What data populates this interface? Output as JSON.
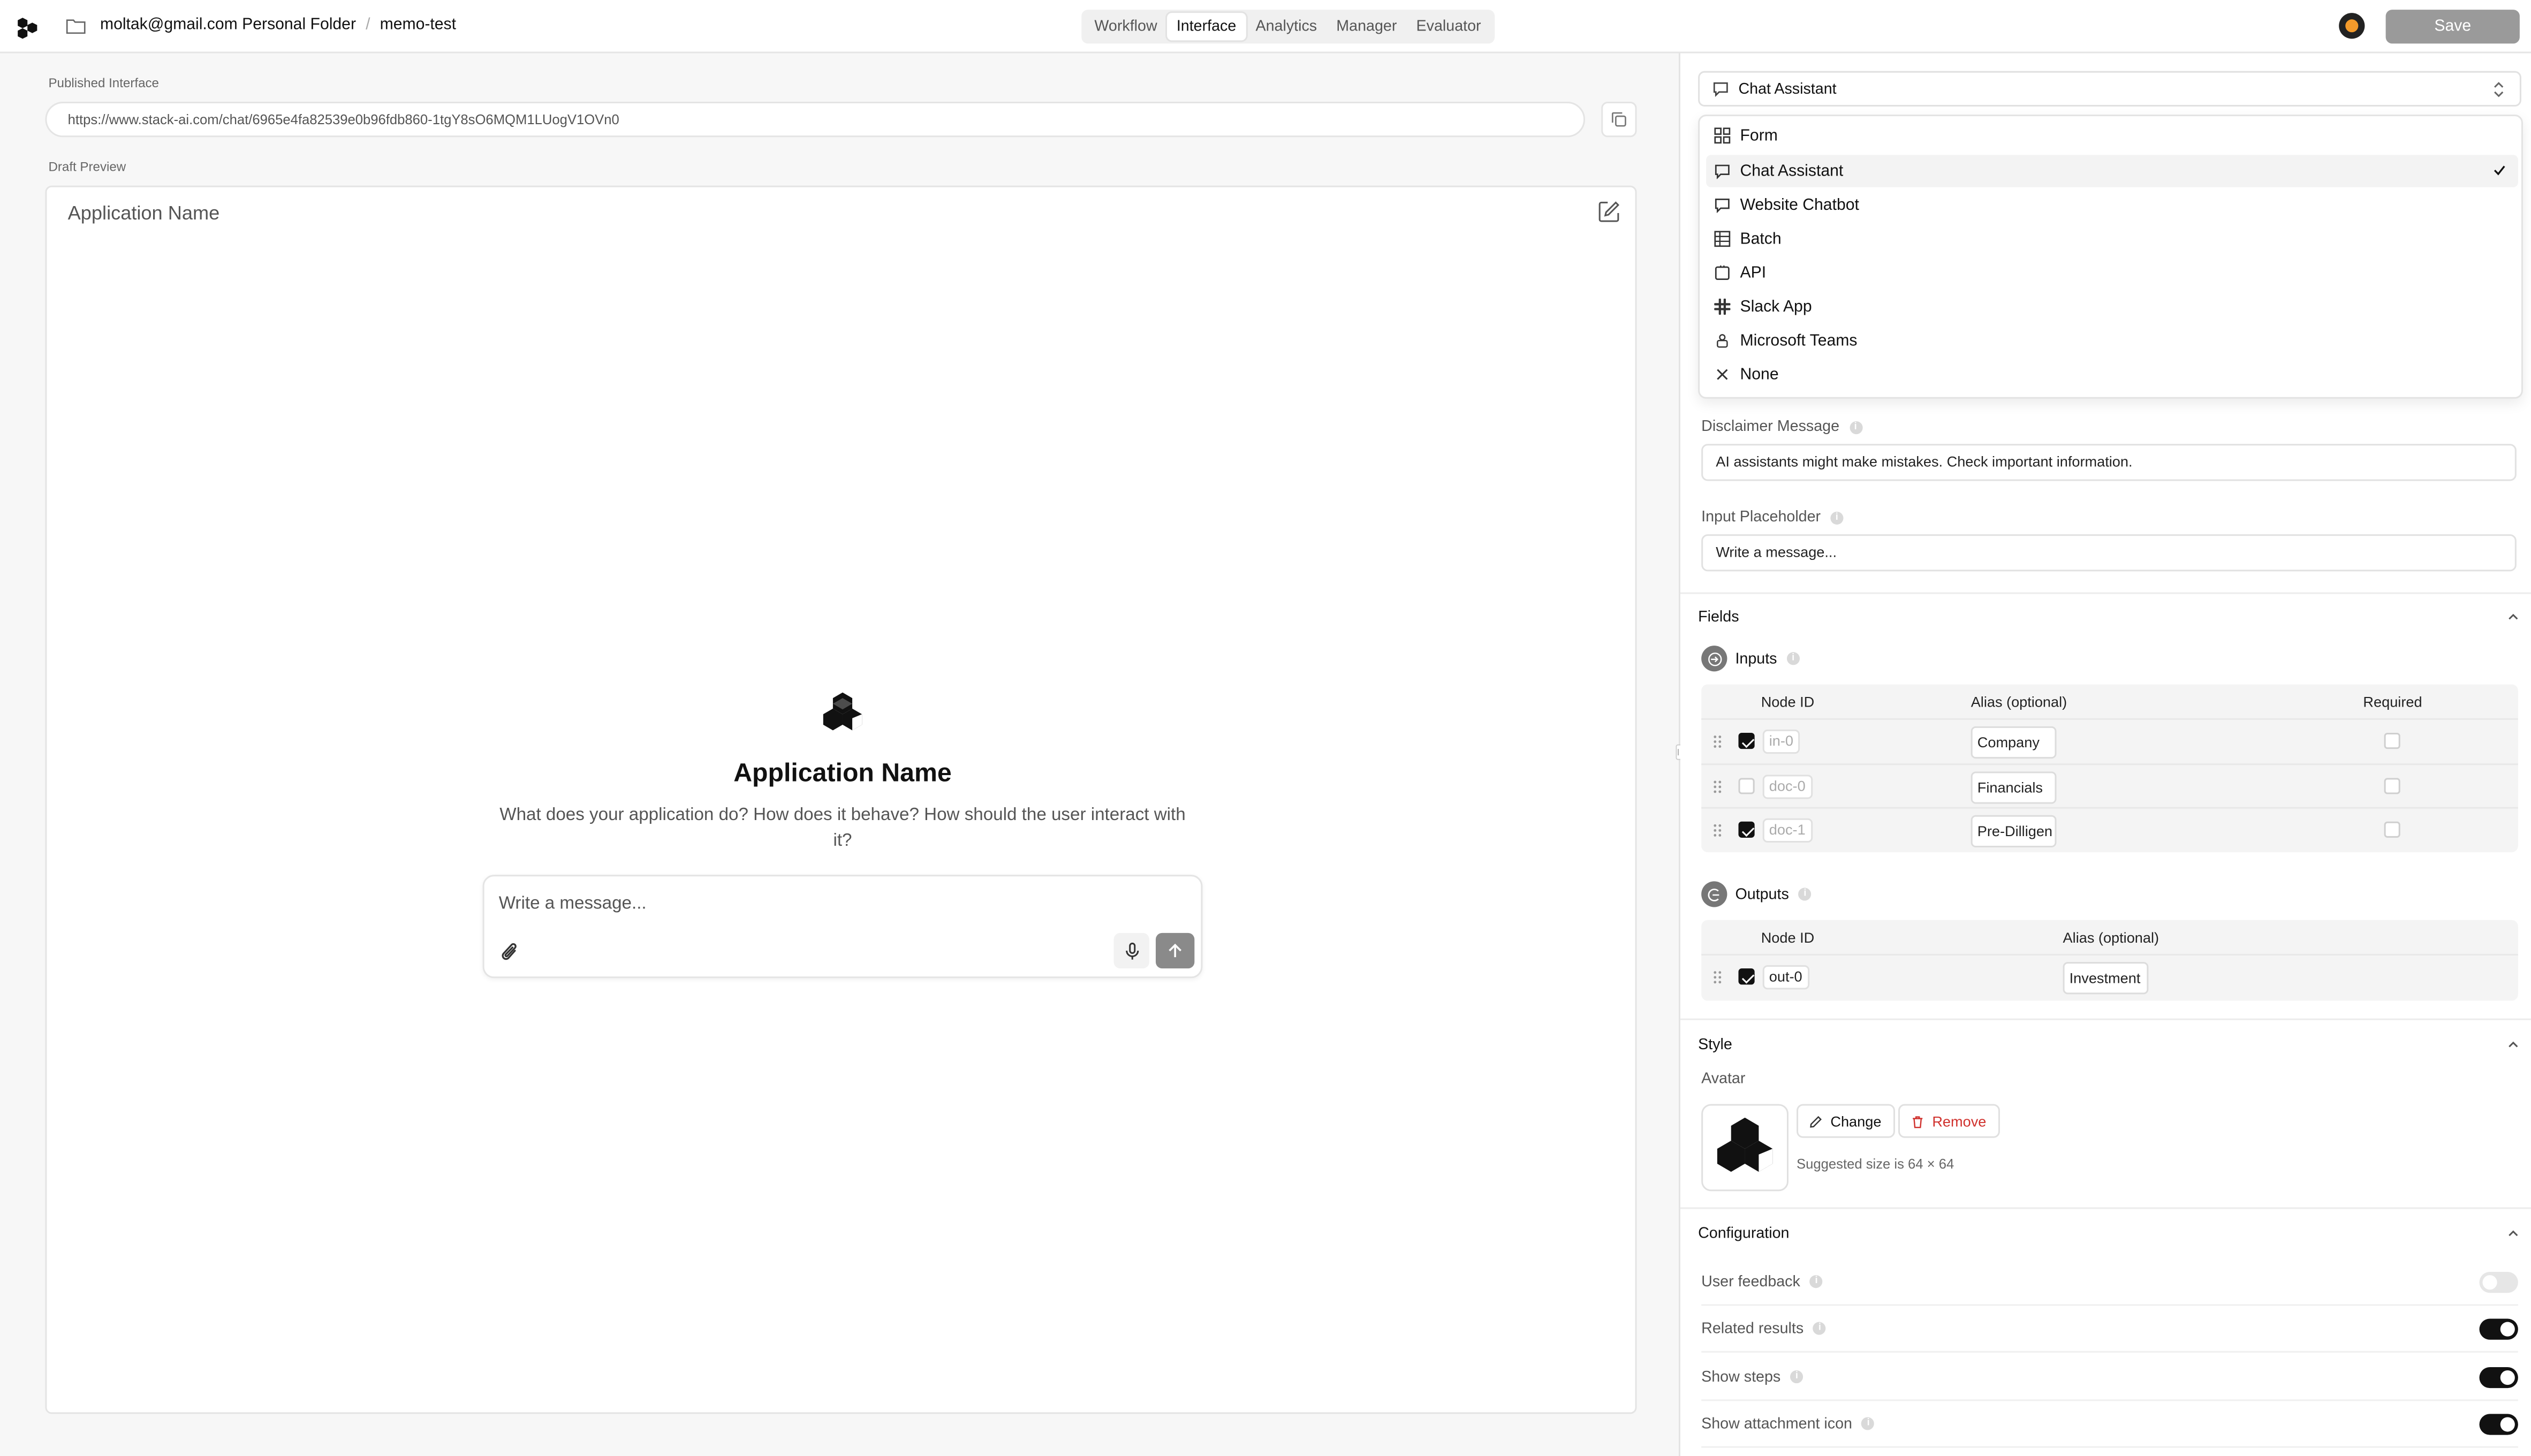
{
  "topbar": {
    "folder": "moltak@gmail.com Personal Folder",
    "sep": "/",
    "project": "memo-test",
    "tabs": [
      "Workflow",
      "Interface",
      "Analytics",
      "Manager",
      "Evaluator"
    ],
    "active_tab": "Interface",
    "save_label": "Save"
  },
  "left": {
    "published_label": "Published Interface",
    "url": "https://www.stack-ai.com/chat/6965e4fa82539e0b96fdb860-1tgY8sO6MQM1LUogV1OVn0",
    "draft_label": "Draft Preview",
    "preview": {
      "header_title": "Application Name",
      "app_name": "Application Name",
      "description": "What does your application do? How does it behave? How should the user interact with it?",
      "input_placeholder": "Write a message..."
    }
  },
  "right": {
    "interface_type": "Chat Assistant",
    "menu": [
      {
        "label": "Form",
        "icon": "grid-icon",
        "selected": false
      },
      {
        "label": "Chat Assistant",
        "icon": "chat-icon",
        "selected": true
      },
      {
        "label": "Website Chatbot",
        "icon": "chat-icon",
        "selected": false
      },
      {
        "label": "Batch",
        "icon": "table-icon",
        "selected": false
      },
      {
        "label": "API",
        "icon": "api-icon",
        "selected": false
      },
      {
        "label": "Slack App",
        "icon": "slack-icon",
        "selected": false
      },
      {
        "label": "Microsoft Teams",
        "icon": "teams-icon",
        "selected": false
      },
      {
        "label": "None",
        "icon": "x-icon",
        "selected": false
      }
    ],
    "disclaimer_label": "Disclaimer Message",
    "disclaimer_value": "AI assistants might make mistakes. Check important information.",
    "placeholder_label": "Input Placeholder",
    "placeholder_value": "Write a message...",
    "fields_title": "Fields",
    "inputs_title": "Inputs",
    "inputs_headers": {
      "node": "Node ID",
      "alias": "Alias (optional)",
      "required": "Required"
    },
    "inputs": [
      {
        "checked": true,
        "node": "in-0",
        "alias": "Company",
        "required": false
      },
      {
        "checked": false,
        "node": "doc-0",
        "alias": "Financials",
        "required": false
      },
      {
        "checked": true,
        "node": "doc-1",
        "alias": "Pre-Dilligen",
        "required": false
      }
    ],
    "outputs_title": "Outputs",
    "outputs_headers": {
      "node": "Node ID",
      "alias": "Alias (optional)"
    },
    "outputs": [
      {
        "checked": true,
        "node": "out-0",
        "alias": "Investment"
      }
    ],
    "style_title": "Style",
    "avatar_label": "Avatar",
    "change_label": "Change",
    "remove_label": "Remove",
    "suggested_size": "Suggested size is 64 × 64",
    "config_title": "Configuration",
    "config": [
      {
        "label": "User feedback",
        "on": false
      },
      {
        "label": "Related results",
        "on": true
      },
      {
        "label": "Show steps",
        "on": true
      },
      {
        "label": "Show attachment icon",
        "on": true
      }
    ]
  },
  "colors": {
    "accent": "#111111",
    "danger": "#d0312d",
    "save_disabled": "#9a9a9a"
  }
}
